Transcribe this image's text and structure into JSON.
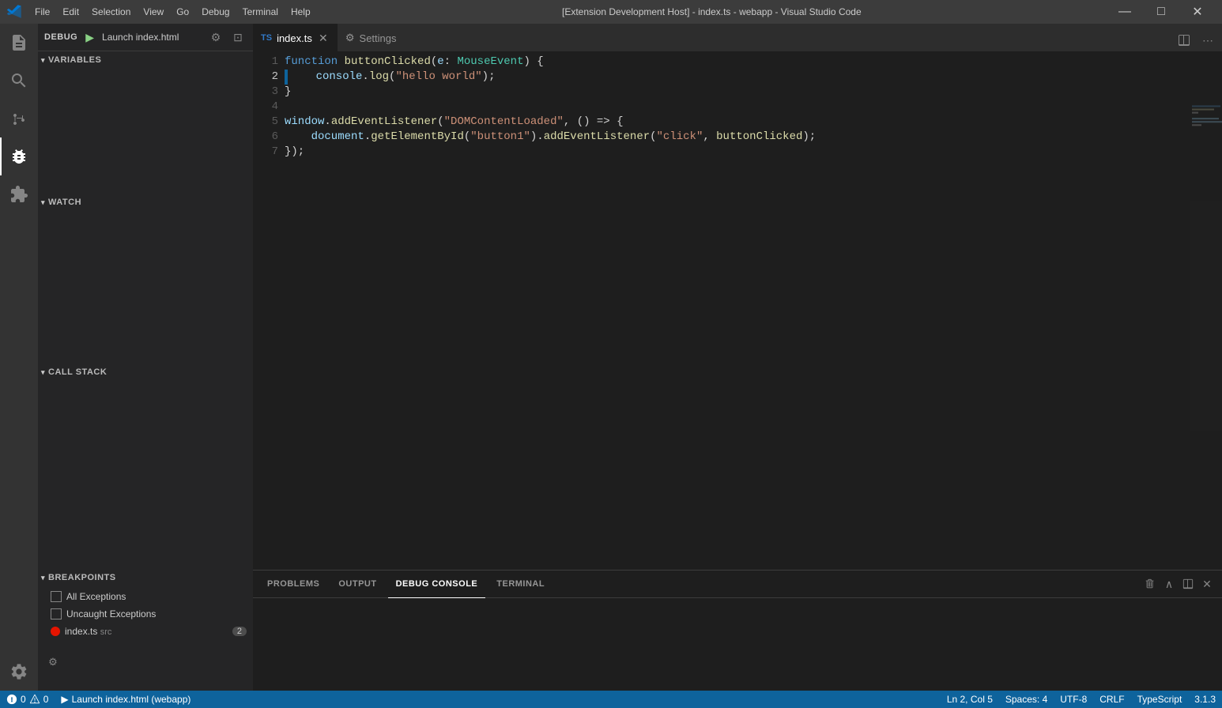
{
  "titleBar": {
    "logo": "VS",
    "menus": [
      "File",
      "Edit",
      "Selection",
      "View",
      "Go",
      "Debug",
      "Terminal",
      "Help"
    ],
    "title": "[Extension Development Host] - index.ts - webapp - Visual Studio Code",
    "minimize": "─",
    "maximize": "□",
    "close": "✕"
  },
  "sidebar": {
    "debugLabel": "DEBUG",
    "runConfig": "Launch index.html",
    "sections": {
      "variables": "VARIABLES",
      "watch": "WATCH",
      "callStack": "CALL STACK",
      "breakpoints": "BREAKPOINTS"
    },
    "breakpoints": [
      {
        "id": "all-exceptions",
        "label": "All Exceptions",
        "checked": false,
        "red": false,
        "count": null
      },
      {
        "id": "uncaught-exceptions",
        "label": "Uncaught Exceptions",
        "checked": false,
        "red": false,
        "count": null
      },
      {
        "id": "index-ts",
        "label": "index.ts",
        "sublabel": "src",
        "checked": true,
        "red": true,
        "count": "2"
      }
    ]
  },
  "tabs": [
    {
      "id": "index-ts",
      "icon": "TS",
      "label": "index.ts",
      "active": true,
      "hasClose": true
    },
    {
      "id": "settings",
      "icon": "⚙",
      "label": "Settings",
      "active": false,
      "hasClose": false
    }
  ],
  "editor": {
    "lines": [
      {
        "num": 1,
        "tokens": [
          {
            "text": "function ",
            "cls": "kw"
          },
          {
            "text": "buttonClicked",
            "cls": "fn"
          },
          {
            "text": "(",
            "cls": "punc"
          },
          {
            "text": "e",
            "cls": "param"
          },
          {
            "text": ": ",
            "cls": "plain"
          },
          {
            "text": "MouseEvent",
            "cls": "type"
          },
          {
            "text": ") {",
            "cls": "punc"
          }
        ],
        "breakpoint": false
      },
      {
        "num": 2,
        "tokens": [
          {
            "text": "    console",
            "cls": "obj"
          },
          {
            "text": ".",
            "cls": "plain"
          },
          {
            "text": "log",
            "cls": "method"
          },
          {
            "text": "(",
            "cls": "punc"
          },
          {
            "text": "\"hello world\"",
            "cls": "str"
          },
          {
            "text": ");",
            "cls": "plain"
          }
        ],
        "breakpoint": true
      },
      {
        "num": 3,
        "tokens": [
          {
            "text": "}",
            "cls": "plain"
          }
        ],
        "breakpoint": false
      },
      {
        "num": 4,
        "tokens": [],
        "breakpoint": false
      },
      {
        "num": 5,
        "tokens": [
          {
            "text": "window",
            "cls": "obj"
          },
          {
            "text": ".",
            "cls": "plain"
          },
          {
            "text": "addEventListener",
            "cls": "method"
          },
          {
            "text": "(",
            "cls": "punc"
          },
          {
            "text": "\"DOMContentLoaded\"",
            "cls": "str"
          },
          {
            "text": ", () => {",
            "cls": "plain"
          }
        ],
        "breakpoint": false
      },
      {
        "num": 6,
        "tokens": [
          {
            "text": "    document",
            "cls": "obj"
          },
          {
            "text": ".",
            "cls": "plain"
          },
          {
            "text": "getElementById",
            "cls": "method"
          },
          {
            "text": "(",
            "cls": "punc"
          },
          {
            "text": "\"button1\"",
            "cls": "str"
          },
          {
            "text": ").",
            "cls": "plain"
          },
          {
            "text": "addEventListener",
            "cls": "method"
          },
          {
            "text": "(",
            "cls": "punc"
          },
          {
            "text": "\"click\"",
            "cls": "str"
          },
          {
            "text": ", ",
            "cls": "plain"
          },
          {
            "text": "buttonClicked",
            "cls": "fn"
          },
          {
            "text": ");",
            "cls": "plain"
          }
        ],
        "breakpoint": false
      },
      {
        "num": 7,
        "tokens": [
          {
            "text": "});",
            "cls": "plain"
          }
        ],
        "breakpoint": false
      }
    ]
  },
  "panel": {
    "tabs": [
      "PROBLEMS",
      "OUTPUT",
      "DEBUG CONSOLE",
      "TERMINAL"
    ],
    "activeTab": "DEBUG CONSOLE"
  },
  "statusBar": {
    "errors": "0",
    "warnings": "0",
    "runLabel": "Launch index.html (webapp)",
    "position": "Ln 2, Col 5",
    "spaces": "Spaces: 4",
    "encoding": "UTF-8",
    "lineEnding": "CRLF",
    "language": "TypeScript",
    "version": "3.1.3"
  },
  "icons": {
    "search": "🔍",
    "sourceControl": "⎇",
    "extensions": "⊞",
    "debug": "🐛",
    "files": "📄",
    "run": "▶",
    "gear": "⚙",
    "split": "⊡",
    "ellipsis": "…",
    "chevronDown": "▾",
    "chevronRight": "▸",
    "close": "×",
    "minimize": "—",
    "maximize": "□",
    "clearAll": "⊟",
    "up": "∧",
    "panelRight": "▣",
    "panelClose": "×"
  }
}
